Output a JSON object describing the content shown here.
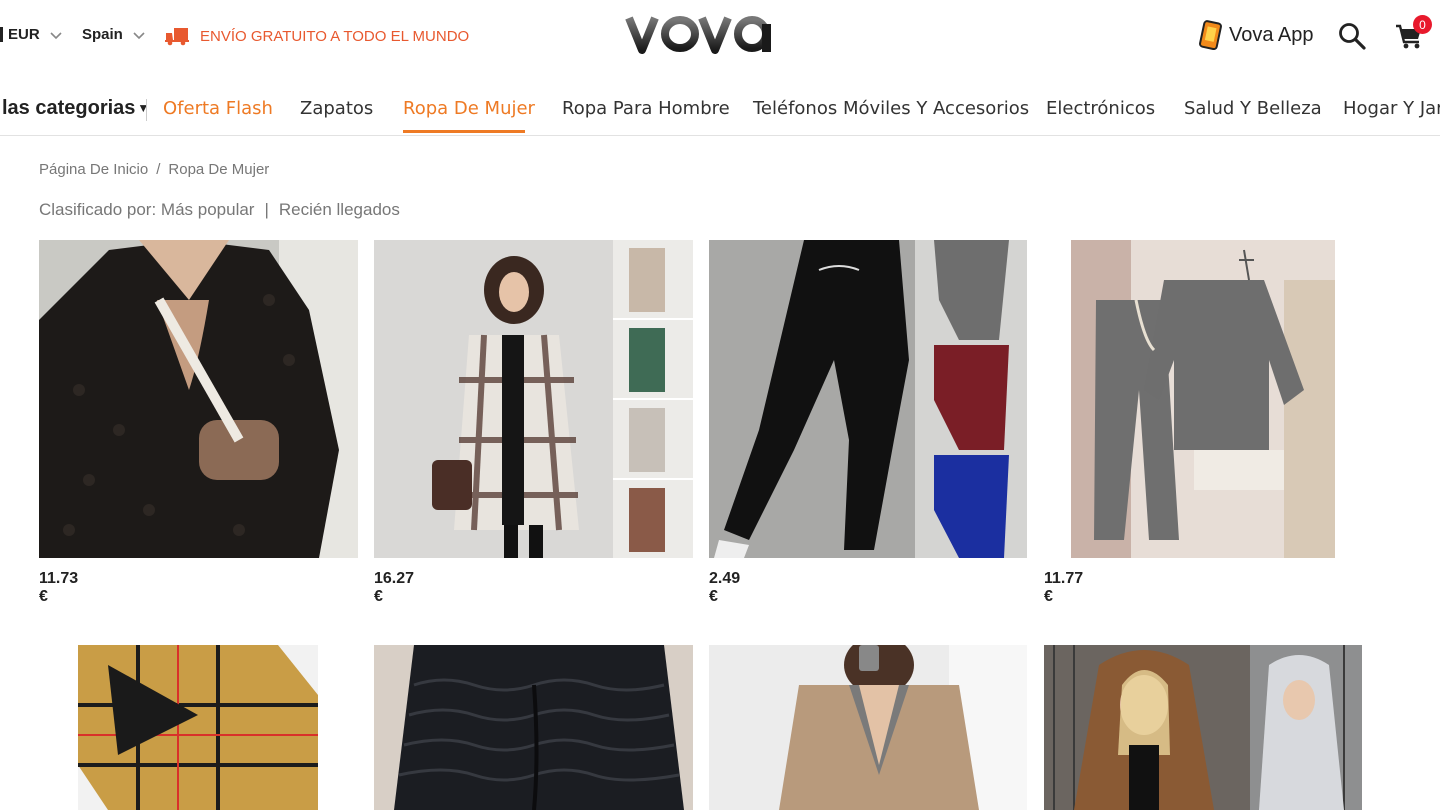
{
  "topbar": {
    "currency": "EUR",
    "country": "Spain",
    "shipping_text": "ENVÍO GRATUITO A TODO EL MUNDO",
    "logo_text": "vova",
    "app_label": "Vova App",
    "cart_count": "0",
    "icons": [
      "truck-icon",
      "phone-app-icon",
      "search-icon",
      "cart-icon",
      "chevron-down-icon"
    ]
  },
  "nav": {
    "all_categories": "las categorias",
    "items": [
      "Oferta Flash",
      "Zapatos",
      "Ropa De Mujer",
      "Ropa Para Hombre",
      "Teléfonos Móviles Y Accesorios",
      "Electrónicos",
      "Salud Y Belleza",
      "Hogar Y Jar"
    ],
    "active": "Ropa De Mujer"
  },
  "breadcrumb": {
    "home": "Página De Inicio",
    "separator": "/",
    "current": "Ropa De Mujer"
  },
  "sort": {
    "label": "Clasificado por:",
    "option_popular": "Más popular",
    "divider": "|",
    "option_new": "Recién llegados"
  },
  "products": [
    {
      "price": "11.73 €",
      "image": "black monogram shirt with crossbody bag"
    },
    {
      "price": "16.27 €",
      "image": "plaid long shirt coat"
    },
    {
      "price": "2.49 €",
      "image": "high waist leggings in black, grey, burgundy, blue"
    },
    {
      "price": "11.77 €",
      "image": "grey sweatshirt and jogger set"
    },
    {
      "price": "",
      "image": "plaid bikini set"
    },
    {
      "price": "",
      "image": "textured black leggings"
    },
    {
      "price": "",
      "image": "camel blazer"
    },
    {
      "price": "",
      "image": "faux fur hooded vest"
    }
  ],
  "colors": {
    "accent": "#ee7a24",
    "shipping": "#e8592f",
    "badge": "#e8192c",
    "text_muted": "#777777"
  }
}
